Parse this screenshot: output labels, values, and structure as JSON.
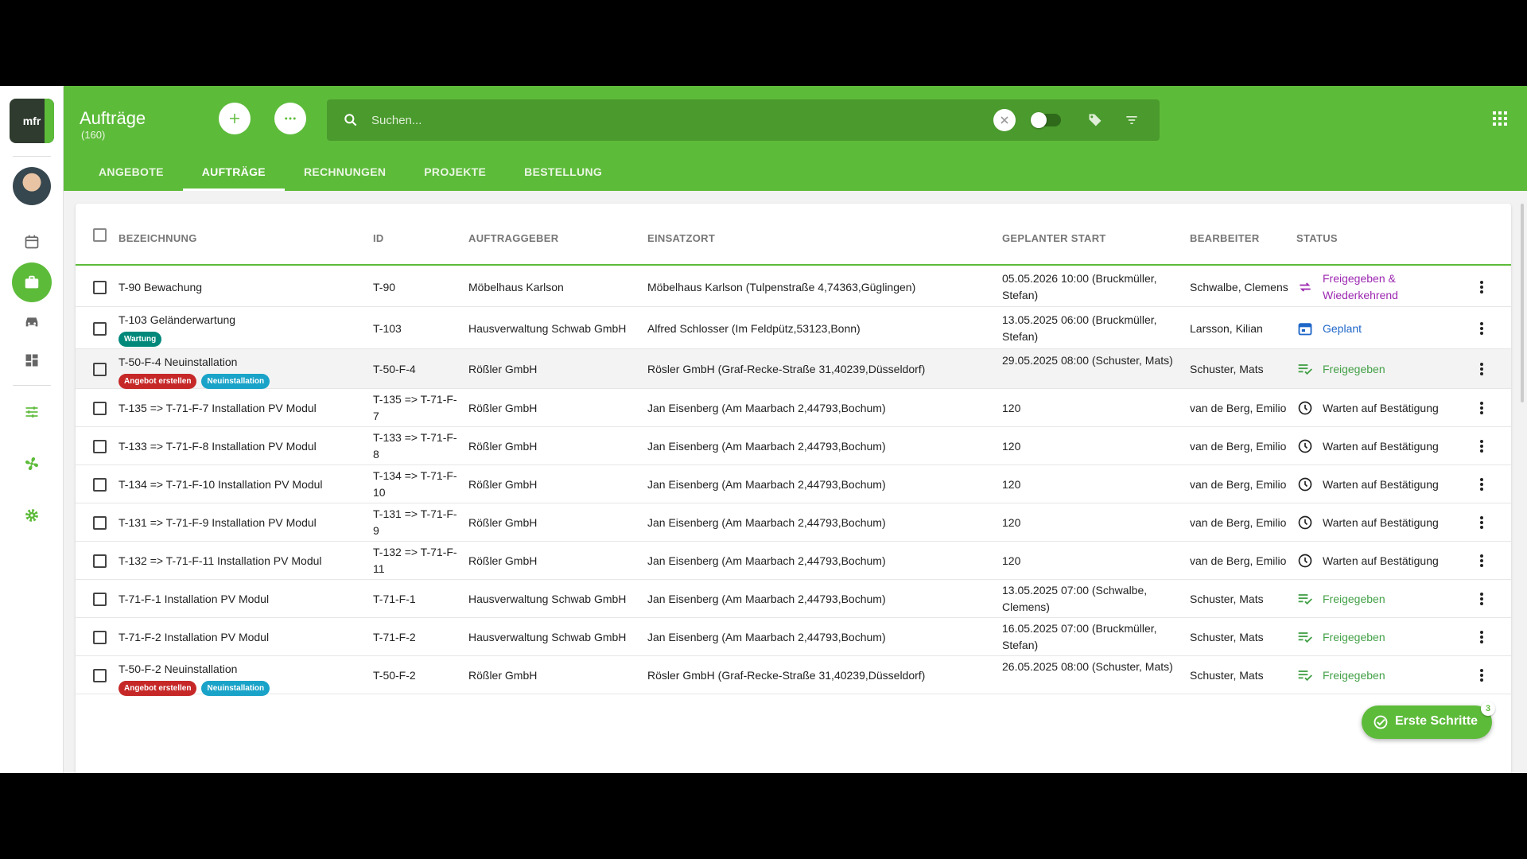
{
  "header": {
    "title": "Aufträge",
    "count": "(160)",
    "search_placeholder": "Suchen...",
    "tabs": [
      {
        "label": "ANGEBOTE",
        "active": false
      },
      {
        "label": "AUFTRÄGE",
        "active": true
      },
      {
        "label": "RECHNUNGEN",
        "active": false
      },
      {
        "label": "PROJEKTE",
        "active": false
      },
      {
        "label": "BESTELLUNG",
        "active": false
      }
    ]
  },
  "logo_text": "mfr",
  "table": {
    "columns": [
      "BEZEICHNUNG",
      "ID",
      "AUFTRAGGEBER",
      "EINSATZORT",
      "GEPLANTER START",
      "BEARBEITER",
      "STATUS"
    ],
    "rows": [
      {
        "name": "T-90 Bewachung",
        "badges": [],
        "id": "T-90",
        "client": "Möbelhaus Karlson",
        "location": "Möbelhaus Karlson (Tulpenstraße 4,74363,Güglingen)",
        "start": "05.05.2026 10:00 (Bruckmüller, Stefan)",
        "assignee": "Schwalbe, Clemens",
        "status": "Freigegeben & Wiederkehrend",
        "status_icon": "repeat-icon",
        "status_color": "#9c27b0"
      },
      {
        "name": "T-103 Geländerwartung",
        "badges": [
          {
            "label": "Wartung",
            "color": "#00897b"
          }
        ],
        "id": "T-103",
        "client": "Hausverwaltung Schwab GmbH",
        "location": "Alfred Schlosser (Im Feldpütz,53123,Bonn)",
        "start": "13.05.2025 06:00 (Bruckmüller, Stefan)",
        "assignee": "Larsson, Kilian",
        "status": "Geplant",
        "status_icon": "calendar-icon",
        "status_color": "#1e66c8"
      },
      {
        "name": "T-50-F-4 Neuinstallation",
        "badges": [
          {
            "label": "Angebot erstellen",
            "color": "#c62828"
          },
          {
            "label": "Neuinstallation",
            "color": "#1aa3c8"
          }
        ],
        "id": "T-50-F-4",
        "client": "Rößler GmbH",
        "location": "Rösler GmbH (Graf-Recke-Straße 31,40239,Düsseldorf)",
        "start": "29.05.2025 08:00 (Schuster, Mats)",
        "assignee": "Schuster, Mats",
        "status": "Freigegeben",
        "status_icon": "checklist-icon",
        "status_color": "#43a047"
      },
      {
        "name": "T-135 => T-71-F-7 Installation PV Modul",
        "badges": [],
        "id": "T-135 => T-71-F-7",
        "client": "Rößler GmbH",
        "location": "Jan Eisenberg (Am Maarbach 2,44793,Bochum)",
        "start": "120",
        "assignee": "van de Berg, Emilio",
        "status": "Warten auf Bestätigung",
        "status_icon": "clock-icon",
        "status_color": "#222222"
      },
      {
        "name": "T-133 => T-71-F-8 Installation PV Modul",
        "badges": [],
        "id": "T-133 => T-71-F-8",
        "client": "Rößler GmbH",
        "location": "Jan Eisenberg (Am Maarbach 2,44793,Bochum)",
        "start": "120",
        "assignee": "van de Berg, Emilio",
        "status": "Warten auf Bestätigung",
        "status_icon": "clock-icon",
        "status_color": "#222222"
      },
      {
        "name": "T-134 => T-71-F-10 Installation PV Modul",
        "badges": [],
        "id": "T-134 => T-71-F-10",
        "client": "Rößler GmbH",
        "location": "Jan Eisenberg (Am Maarbach 2,44793,Bochum)",
        "start": "120",
        "assignee": "van de Berg, Emilio",
        "status": "Warten auf Bestätigung",
        "status_icon": "clock-icon",
        "status_color": "#222222"
      },
      {
        "name": "T-131 => T-71-F-9 Installation PV Modul",
        "badges": [],
        "id": "T-131 => T-71-F-9",
        "client": "Rößler GmbH",
        "location": "Jan Eisenberg (Am Maarbach 2,44793,Bochum)",
        "start": "120",
        "assignee": "van de Berg, Emilio",
        "status": "Warten auf Bestätigung",
        "status_icon": "clock-icon",
        "status_color": "#222222"
      },
      {
        "name": "T-132 => T-71-F-11 Installation PV Modul",
        "badges": [],
        "id": "T-132 => T-71-F-11",
        "client": "Rößler GmbH",
        "location": "Jan Eisenberg (Am Maarbach 2,44793,Bochum)",
        "start": "120",
        "assignee": "van de Berg, Emilio",
        "status": "Warten auf Bestätigung",
        "status_icon": "clock-icon",
        "status_color": "#222222"
      },
      {
        "name": "T-71-F-1 Installation PV Modul",
        "badges": [],
        "id": "T-71-F-1",
        "client": "Hausverwaltung Schwab GmbH",
        "location": "Jan Eisenberg (Am Maarbach 2,44793,Bochum)",
        "start": "13.05.2025 07:00 (Schwalbe, Clemens)",
        "assignee": "Schuster, Mats",
        "status": "Freigegeben",
        "status_icon": "checklist-icon",
        "status_color": "#43a047"
      },
      {
        "name": "T-71-F-2 Installation PV Modul",
        "badges": [],
        "id": "T-71-F-2",
        "client": "Hausverwaltung Schwab GmbH",
        "location": "Jan Eisenberg (Am Maarbach 2,44793,Bochum)",
        "start": "16.05.2025 07:00 (Bruckmüller, Stefan)",
        "assignee": "Schuster, Mats",
        "status": "Freigegeben",
        "status_icon": "checklist-icon",
        "status_color": "#43a047"
      },
      {
        "name": "T-50-F-2 Neuinstallation",
        "badges": [
          {
            "label": "Angebot erstellen",
            "color": "#c62828"
          },
          {
            "label": "Neuinstallation",
            "color": "#1aa3c8"
          }
        ],
        "id": "T-50-F-2",
        "client": "Rößler GmbH",
        "location": "Rösler GmbH (Graf-Recke-Straße 31,40239,Düsseldorf)",
        "start": "26.05.2025 08:00 (Schuster, Mats)",
        "assignee": "Schuster, Mats",
        "status": "Freigegeben",
        "status_icon": "checklist-icon",
        "status_color": "#43a047"
      }
    ]
  },
  "fab": {
    "label": "Erste Schritte",
    "badge": "3"
  },
  "colors": {
    "brand": "#5dbb3a",
    "brand_dark": "#4a9a2d"
  }
}
